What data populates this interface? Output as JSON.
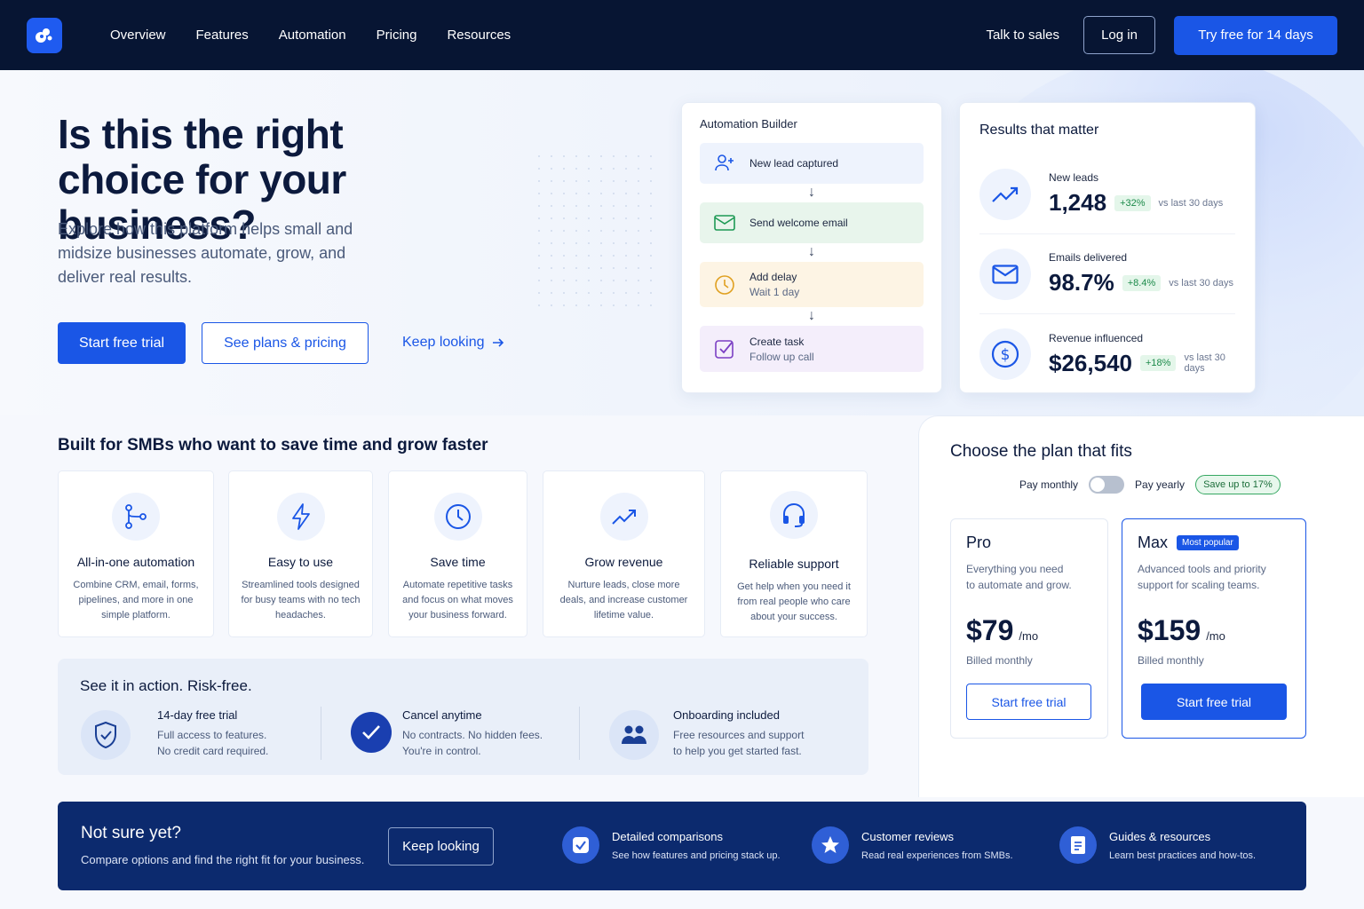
{
  "nav": {
    "links": [
      "Overview",
      "Features",
      "Automation",
      "Pricing",
      "Resources"
    ],
    "talk": "Talk to sales",
    "login": "Log in",
    "try": "Try free for 14 days"
  },
  "hero": {
    "title_line1": "Is this the right",
    "title_line2": "choice for your business?",
    "subtitle": "Explore how this platform helps small and midsize businesses automate, grow, and deliver real results.",
    "cta_primary": "Start free trial",
    "cta_secondary": "See plans & pricing",
    "cta_link": "Keep looking"
  },
  "automation": {
    "title": "Automation Builder",
    "steps": [
      {
        "label": "New lead captured",
        "sub": ""
      },
      {
        "label": "Send welcome email",
        "sub": ""
      },
      {
        "label": "Add delay",
        "sub": "Wait 1 day"
      },
      {
        "label": "Create task",
        "sub": "Follow up call"
      }
    ]
  },
  "results": {
    "title": "Results that matter",
    "rows": [
      {
        "label": "New leads",
        "value": "1,248",
        "change": "+32%",
        "vs": "vs last 30 days"
      },
      {
        "label": "Emails delivered",
        "value": "98.7%",
        "change": "+8.4%",
        "vs": "vs last 30 days"
      },
      {
        "label": "Revenue influenced",
        "value": "$26,540",
        "change": "+18%",
        "vs": "vs last 30 days"
      }
    ]
  },
  "built": {
    "title": "Built for SMBs who want to save time and grow faster",
    "features": [
      {
        "title": "All-in-one automation",
        "desc": "Combine CRM, email, forms, pipelines, and more in one simple platform."
      },
      {
        "title": "Easy to use",
        "desc": "Streamlined tools designed for busy teams with no tech headaches."
      },
      {
        "title": "Save time",
        "desc": "Automate repetitive tasks and focus on what moves your business forward."
      },
      {
        "title": "Grow revenue",
        "desc": "Nurture leads, close more deals, and increase customer lifetime value."
      },
      {
        "title": "Reliable support",
        "desc": "Get help when you need it from real people who care about your success."
      }
    ]
  },
  "action": {
    "title": "See it in action. Risk-free.",
    "items": [
      {
        "title": "14-day free trial",
        "line1": "Full access to features.",
        "line2": "No credit card required."
      },
      {
        "title": "Cancel anytime",
        "line1": "No contracts. No hidden fees.",
        "line2": "You're in control."
      },
      {
        "title": "Onboarding included",
        "line1": "Free resources and support",
        "line2": "to help you get started fast."
      }
    ]
  },
  "plans": {
    "title": "Choose the plan that fits",
    "monthly": "Pay monthly",
    "yearly": "Pay yearly",
    "save": "Save up to 17%",
    "pro": {
      "name": "Pro",
      "desc_line1": "Everything you need",
      "desc_line2": "to automate and grow.",
      "price": "$79",
      "per": "/mo",
      "billed": "Billed monthly",
      "cta": "Start free trial"
    },
    "max": {
      "name": "Max",
      "badge": "Most popular",
      "desc_line1": "Advanced tools and priority",
      "desc_line2": "support for scaling teams.",
      "price": "$159",
      "per": "/mo",
      "billed": "Billed monthly",
      "cta": "Start free trial"
    }
  },
  "banner": {
    "title": "Not sure yet?",
    "sub": "Compare options and find the right fit for your business.",
    "button": "Keep looking",
    "items": [
      {
        "title": "Detailed comparisons",
        "desc": "See how features and pricing stack up."
      },
      {
        "title": "Customer reviews",
        "desc": "Read real experiences from SMBs."
      },
      {
        "title": "Guides & resources",
        "desc": "Learn best practices and how-tos."
      }
    ]
  },
  "colors": {
    "accent": "#1a56e6",
    "nav_bg": "#071533",
    "banner_bg": "#0c2a6e",
    "green": "#1c8a4a"
  }
}
